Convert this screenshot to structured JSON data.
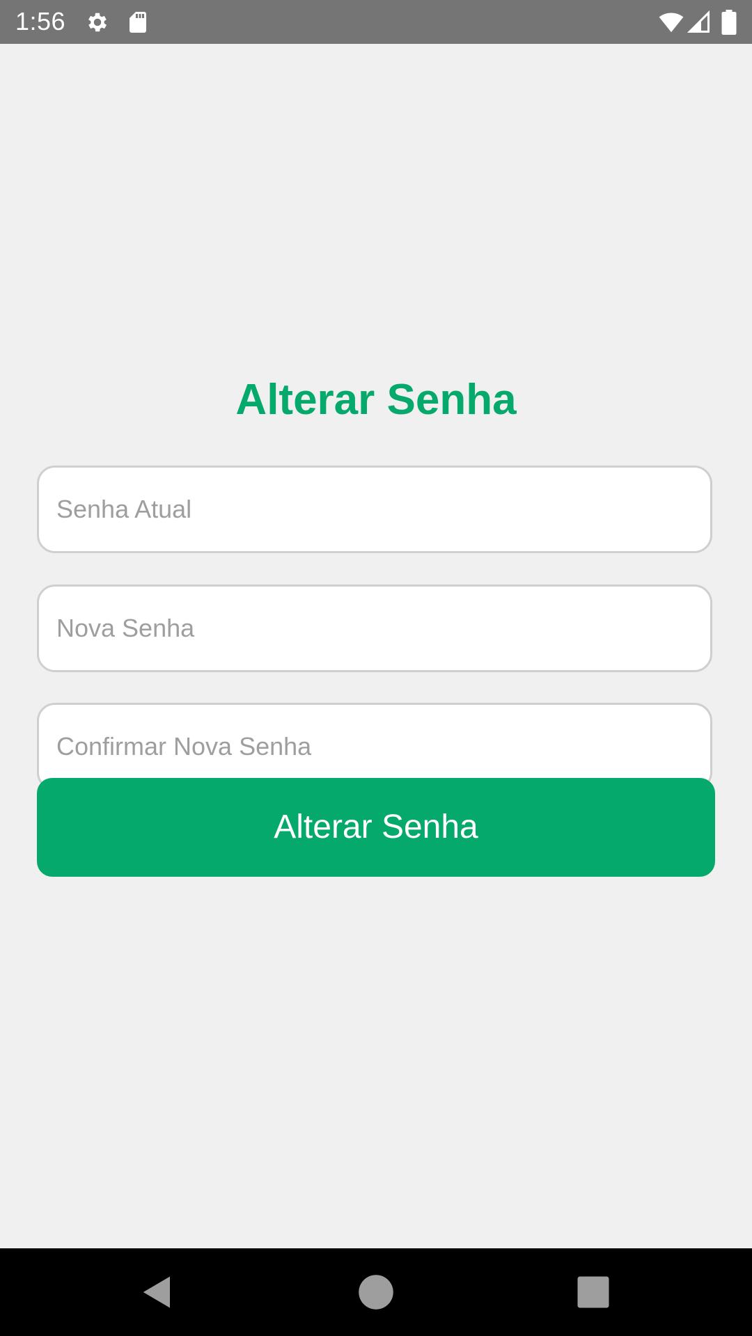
{
  "status_bar": {
    "time": "1:56",
    "icons": [
      "settings-gear-icon",
      "sd-card-icon",
      "wifi-icon",
      "cellular-signal-icon",
      "battery-icon"
    ]
  },
  "form": {
    "title": "Alterar Senha",
    "current_password": {
      "placeholder": "Senha Atual",
      "value": ""
    },
    "new_password": {
      "placeholder": "Nova Senha",
      "value": ""
    },
    "confirm_password": {
      "placeholder": "Confirmar Nova Senha",
      "value": ""
    },
    "submit_label": "Alterar Senha"
  },
  "nav_bar": {
    "buttons": [
      "back-icon",
      "home-icon",
      "recents-icon"
    ]
  },
  "colors": {
    "accent": "#05a96b",
    "status_bar": "#757575",
    "background": "#f0f0f0",
    "nav_bar": "#000000"
  }
}
